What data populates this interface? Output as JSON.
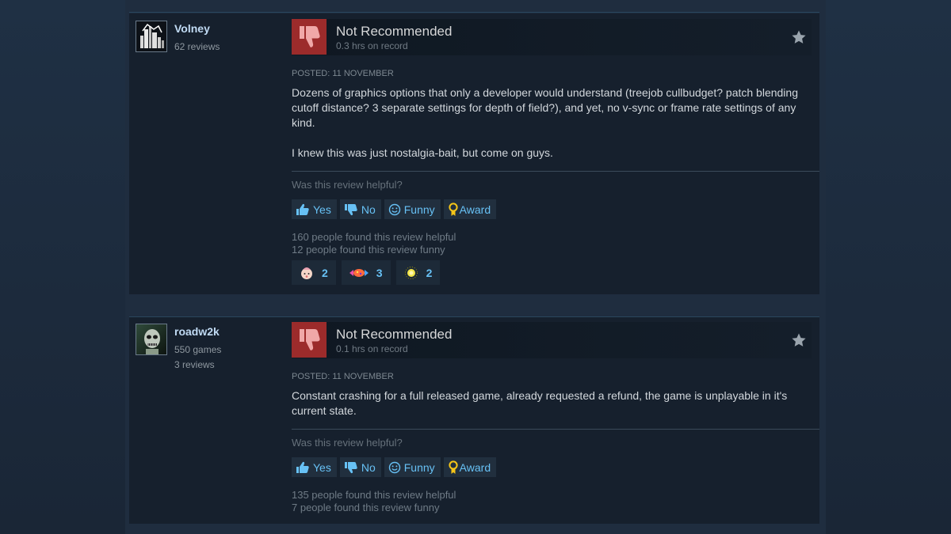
{
  "reviews": [
    {
      "username": "Volney",
      "user_lines": [
        "62 reviews"
      ],
      "verdict": "Not Recommended",
      "hours": "0.3 hrs on record",
      "posted": "POSTED: 11 NOVEMBER",
      "paragraphs": [
        "Dozens of graphics options that only a developer would understand (treejob cullbudget? patch blending cutoff distance? 3 separate settings for depth of field?), and yet, no v-sync or frame rate settings of any kind.",
        "I knew this was just nostalgia-bait, but come on guys."
      ],
      "helpful_question": "Was this review helpful?",
      "buttons": {
        "yes": "Yes",
        "no": "No",
        "funny": "Funny",
        "award": "Award"
      },
      "helpful_count": "160 people found this review helpful",
      "funny_count": "12 people found this review funny",
      "awards": [
        {
          "icon": "baby-face-award-icon",
          "count": "2"
        },
        {
          "icon": "candy-award-icon",
          "count": "3"
        },
        {
          "icon": "sparkle-award-icon",
          "count": "2"
        }
      ]
    },
    {
      "username": "roadw2k",
      "user_lines": [
        "550 games",
        "3 reviews"
      ],
      "verdict": "Not Recommended",
      "hours": "0.1 hrs on record",
      "posted": "POSTED: 11 NOVEMBER",
      "paragraphs": [
        "Constant crashing for a full released game, already requested a refund, the game is unplayable in it's current state."
      ],
      "helpful_question": "Was this review helpful?",
      "buttons": {
        "yes": "Yes",
        "no": "No",
        "funny": "Funny",
        "award": "Award"
      },
      "helpful_count": "135 people found this review helpful",
      "funny_count": "7 people found this review funny"
    }
  ],
  "colors": {
    "thumb_down_bg": "#9c2b2b",
    "link_blue": "#67c1f5",
    "username": "#c1dbf4",
    "award_gold": "#f5c518"
  }
}
